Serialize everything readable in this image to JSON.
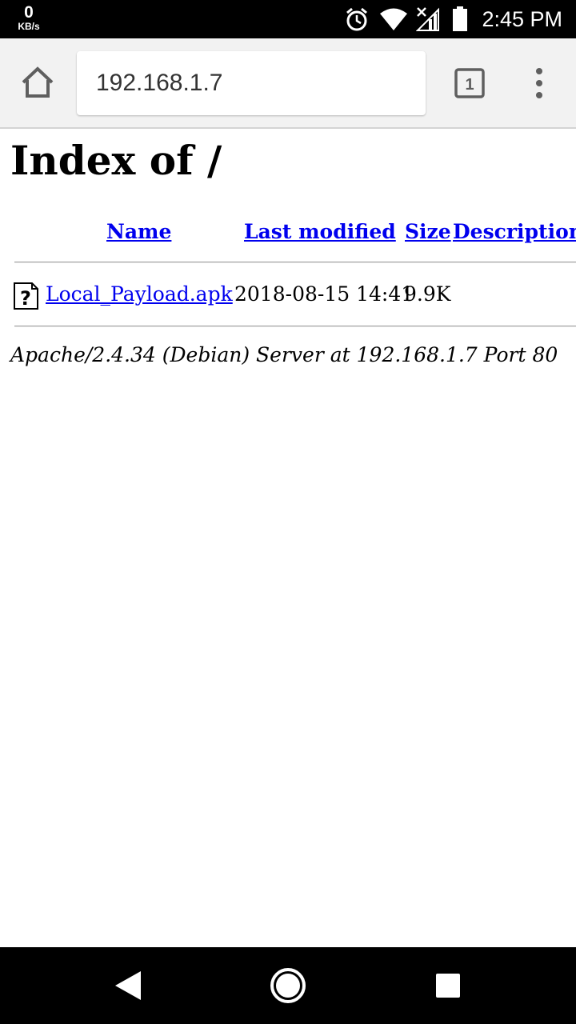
{
  "status_bar": {
    "net_speed_value": "0",
    "net_speed_unit": "KB/s",
    "time": "2:45 PM",
    "icons": [
      "alarm-icon",
      "wifi-icon",
      "signal-off-icon",
      "battery-icon"
    ]
  },
  "toolbar": {
    "url": "192.168.1.7",
    "tab_count": "1",
    "icons": [
      "home-icon",
      "tab-switcher-icon",
      "overflow-menu-icon"
    ]
  },
  "page": {
    "title": "Index of /",
    "columns": [
      "Name",
      "Last modified",
      "Size",
      "Description"
    ],
    "rows": [
      {
        "icon": "unknown-file-icon",
        "name": "Local_Payload.apk",
        "last_modified": "2018-08-15 14:41",
        "size": "9.9K",
        "description": ""
      }
    ],
    "footer": "Apache/2.4.34 (Debian) Server at 192.168.1.7 Port 80"
  },
  "nav_bar": {
    "icons": [
      "back-icon",
      "home-circle-icon",
      "recents-icon"
    ]
  },
  "colors": {
    "link": "#0000ee",
    "toolbar_bg": "#f2f2f2",
    "system_bar_bg": "#000000"
  }
}
